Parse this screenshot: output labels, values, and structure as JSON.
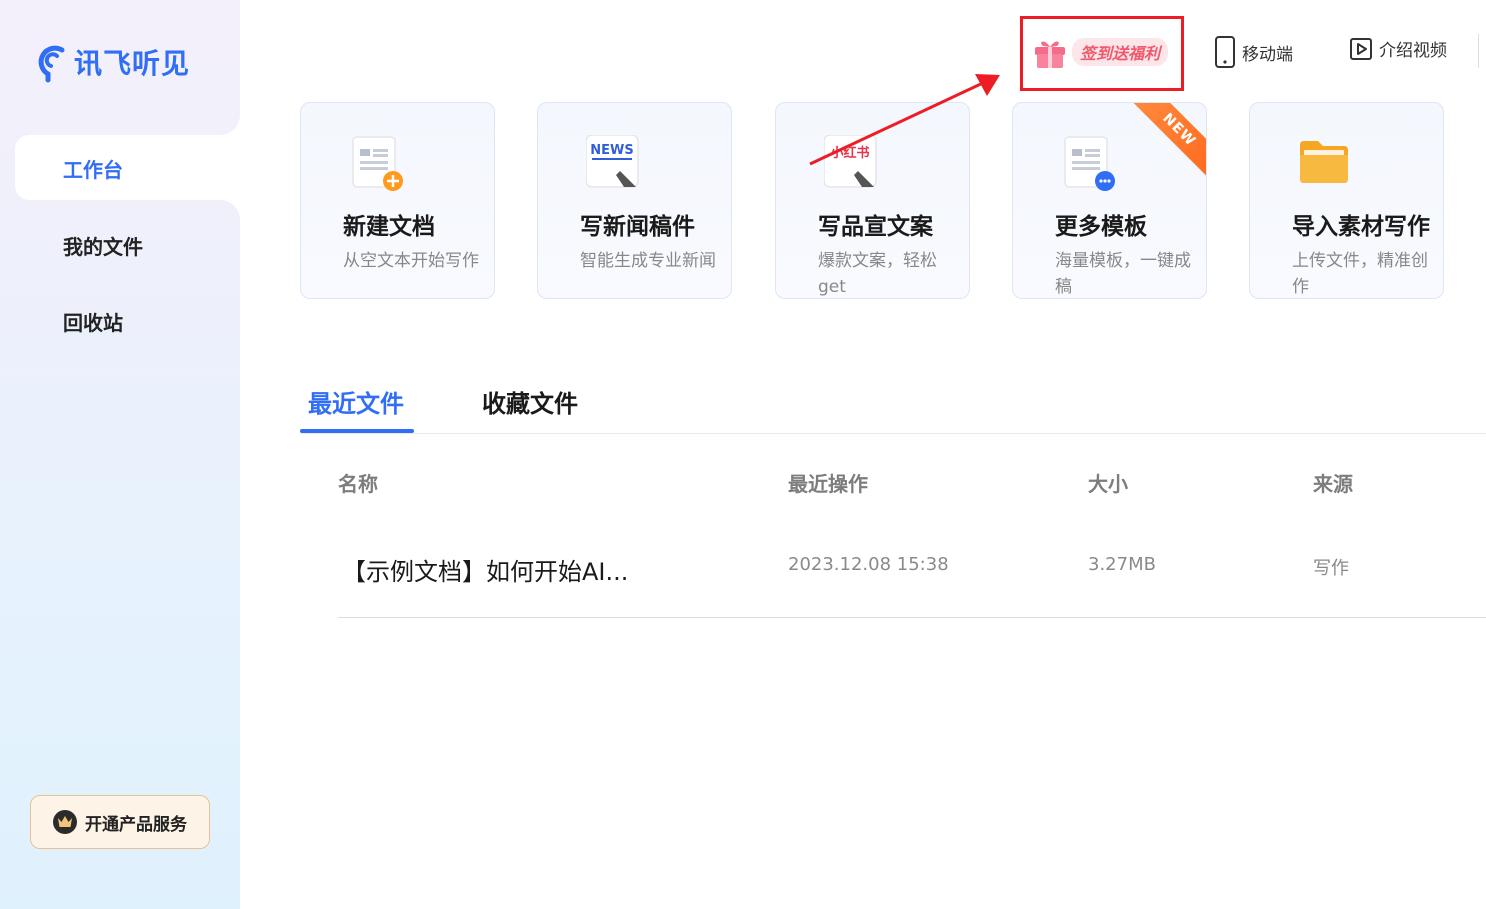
{
  "app": {
    "logo_text": "讯飞听见"
  },
  "sidebar": {
    "items": [
      {
        "label": "工作台",
        "active": true
      },
      {
        "label": "我的文件",
        "active": false
      },
      {
        "label": "回收站",
        "active": false
      }
    ],
    "upgrade_label": "开通产品服务"
  },
  "topbar": {
    "signin_label": "签到送福利",
    "mobile_label": "移动端",
    "video_label": "介绍视频"
  },
  "cards": [
    {
      "title": "新建文档",
      "desc": "从空文本开始写作",
      "icon": "new-doc-icon"
    },
    {
      "title": "写新闻稿件",
      "desc": "智能生成专业新闻",
      "icon": "news-icon",
      "icon_text": "NEWS"
    },
    {
      "title": "写品宣文案",
      "desc": "爆款文案，轻松get",
      "icon": "xiaohongshu-icon",
      "icon_text": "小红书"
    },
    {
      "title": "更多模板",
      "desc": "海量模板，一键成稿",
      "icon": "template-icon",
      "badge": "NEW"
    },
    {
      "title": "导入素材写作",
      "desc": "上传文件，精准创作",
      "icon": "folder-icon"
    }
  ],
  "tabs": [
    {
      "label": "最近文件",
      "active": true
    },
    {
      "label": "收藏文件",
      "active": false
    }
  ],
  "table": {
    "columns": [
      "名称",
      "最近操作",
      "大小",
      "来源"
    ],
    "rows": [
      {
        "name": "【示例文档】如何开始AI...",
        "time": "2023.12.08 15:38",
        "size": "3.27MB",
        "source": "写作"
      }
    ]
  },
  "colors": {
    "accent": "#2f6ef5",
    "annotation": "#ee1c25",
    "ribbon": "#ff7a2a"
  }
}
